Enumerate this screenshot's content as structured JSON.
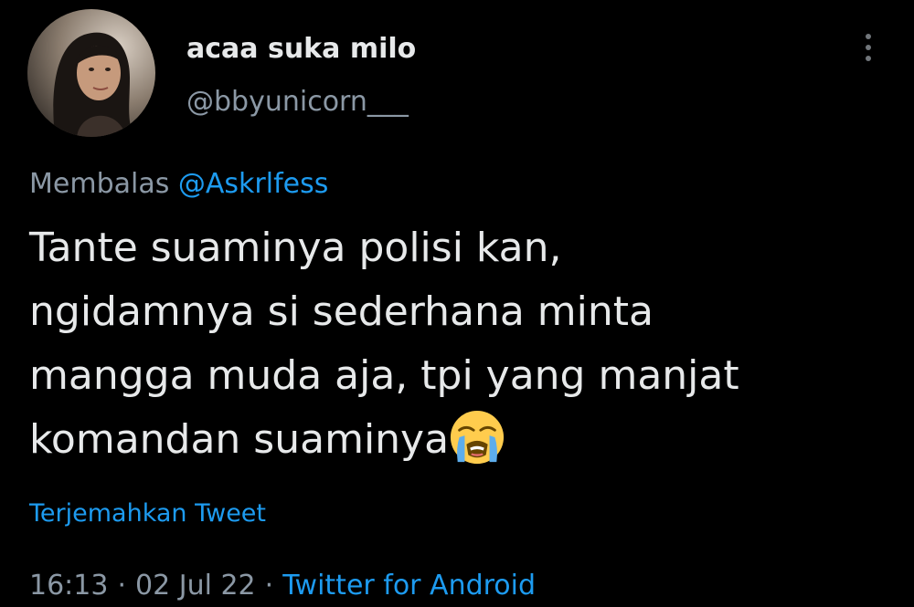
{
  "user": {
    "display_name": "acaa suka milo",
    "handle": "@bbyunicorn___"
  },
  "reply": {
    "prefix": "Membalas",
    "mention": "@Askrlfess"
  },
  "tweet": {
    "lines": [
      "Tante suaminya polisi kan,",
      "ngidamnya si sederhana minta",
      "mangga muda aja, tpi yang manjat",
      "komandan suaminya"
    ],
    "emoji": "loudly-crying-face-emoji"
  },
  "translate_label": "Terjemahkan Tweet",
  "meta": {
    "time": "16:13",
    "date": "02 Jul 22",
    "separator": "·",
    "source": "Twitter for Android"
  },
  "icons": {
    "more": "more-vertical-icon"
  },
  "colors": {
    "background": "#000000",
    "primary_text": "#e7e9ea",
    "secondary_text": "#8b98a5",
    "accent": "#1d9bf0"
  }
}
